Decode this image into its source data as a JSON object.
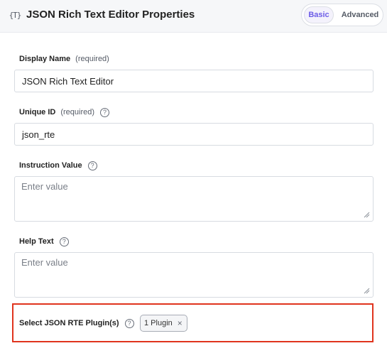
{
  "header": {
    "icon": "rich-text-icon",
    "icon_glyph": "{T}",
    "title": "JSON Rich Text Editor Properties",
    "tabs": {
      "basic": "Basic",
      "advanced": "Advanced",
      "active": "Basic"
    }
  },
  "fields": {
    "display_name": {
      "label": "Display Name",
      "hint": "(required)",
      "value": "JSON Rich Text Editor"
    },
    "unique_id": {
      "label": "Unique ID",
      "hint": "(required)",
      "help": "?",
      "value": "json_rte"
    },
    "instruction_value": {
      "label": "Instruction Value",
      "help": "?",
      "placeholder": "Enter value"
    },
    "help_text": {
      "label": "Help Text",
      "help": "?",
      "placeholder": "Enter value"
    },
    "plugins": {
      "label": "Select JSON RTE Plugin(s)",
      "help": "?",
      "chip": "1 Plugin",
      "chip_close": "×"
    }
  },
  "colors": {
    "accent": "#6c5ce7",
    "highlight_border": "#e0341e",
    "header_bg": "#f6f7f9"
  }
}
